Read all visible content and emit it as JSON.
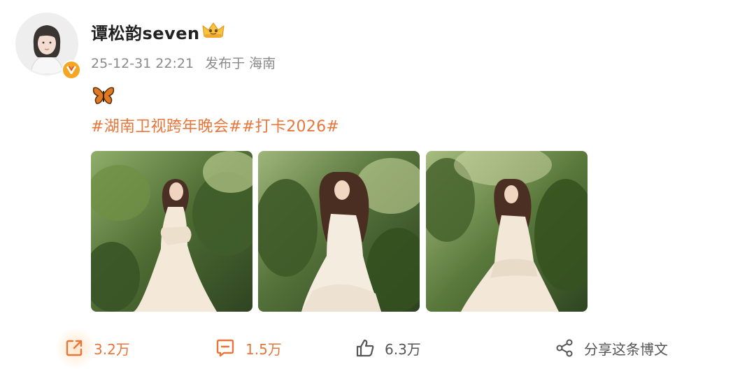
{
  "post": {
    "username": "谭松韵seven",
    "timestamp": "25-12-31 22:21",
    "location": "发布于 海南",
    "emoji": "butterfly-icon",
    "hashtags": "#湖南卫视跨年晚会##打卡2026#"
  },
  "photos": [
    {
      "name": "photo-1",
      "desc_icon": "photo"
    },
    {
      "name": "photo-2",
      "desc_icon": "photo"
    },
    {
      "name": "photo-3",
      "desc_icon": "photo"
    }
  ],
  "actions": {
    "repost_count": "3.2万",
    "comment_count": "1.5万",
    "like_count": "6.3万",
    "share_label": "分享这条博文"
  },
  "colors": {
    "accent": "#e8763a",
    "verified_badge": "#f5a623",
    "meta_text": "#8a8a8a"
  }
}
